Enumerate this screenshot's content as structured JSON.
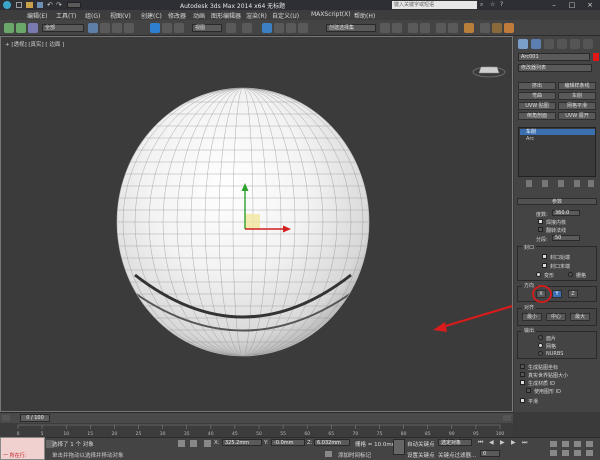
{
  "titlebar": {
    "title": "Autodesk 3ds Max  2014 x64    无标题",
    "search_placeholder": "键入关键字或短语"
  },
  "menubar": {
    "items": [
      "编辑(E)",
      "工具(T)",
      "组(G)",
      "视图(V)",
      "创建(C)",
      "修改器",
      "动画",
      "图形编辑器",
      "渲染(R)",
      "自定义(U)",
      "MAXScript(X)",
      "帮助(H)"
    ]
  },
  "toolbar": {
    "filter_dropdown": "全部",
    "refcoord_dropdown": "视图",
    "selection_set": "创建选择集"
  },
  "viewport": {
    "label": "+ [透视] [真实] [ 边面 ]",
    "gizmo_axes": {
      "x": "X",
      "y": "Y"
    }
  },
  "command_panel": {
    "object_name": "Arc001",
    "modifier_list": "修改器列表",
    "buttons": [
      "挤出",
      "编辑样条线",
      "弯曲",
      "车削",
      "UVW 贴图",
      "网格平滑",
      "倒角剖面",
      "UVW 展开"
    ],
    "stack": [
      "车削",
      "Arc"
    ],
    "params_title": "参数",
    "degrees_label": "度数:",
    "degrees_value": "360.0",
    "weld_core": "焊接内核",
    "flip_normals": "翻转法线",
    "segments_label": "分段:",
    "segments_value": "50",
    "capping_title": "封口",
    "cap_start": "封口始端",
    "cap_end": "封口末端",
    "morph": "变形",
    "grid": "栅格",
    "direction_title": "方向",
    "dir_x": "X",
    "dir_y": "Y",
    "dir_z": "Z",
    "align_title": "对齐",
    "align_min": "最小",
    "align_center": "中心",
    "align_max": "最大",
    "output_title": "输出",
    "out_patch": "面片",
    "out_mesh": "网格",
    "out_nurbs": "NURBS",
    "gen_map_coords": "生成贴图坐标",
    "real_world_map": "真实世界贴图大小",
    "gen_mat_ids": "生成材质 ID",
    "use_shape_ids": "使用图形 ID",
    "smooth": "平滑"
  },
  "timeline": {
    "frame_readout": "0 / 100",
    "ticks": [
      "0",
      "5",
      "10",
      "15",
      "20",
      "25",
      "30",
      "35",
      "40",
      "45",
      "50",
      "55",
      "60",
      "65",
      "70",
      "75",
      "80",
      "85",
      "90",
      "95",
      "100"
    ]
  },
  "statusbar": {
    "maxscript_label": "一 所在行:",
    "selected_text": "选择了 1 个 对象",
    "prompt_text": "单击并拖动以选择并移动对象",
    "x_label": "X:",
    "x_value": "325.2mm",
    "y_label": "Y:",
    "y_value": "-0.0mm",
    "z_label": "Z:",
    "z_value": "6.032mm",
    "grid_label": "栅格 = 10.0mm",
    "add_time_tag": "添加时间标记",
    "auto_key": "自动关键点",
    "selected_dropdown": "选定对象",
    "set_key": "设置关键点",
    "key_filters": "关键点过滤器...",
    "frame_value": "0"
  }
}
